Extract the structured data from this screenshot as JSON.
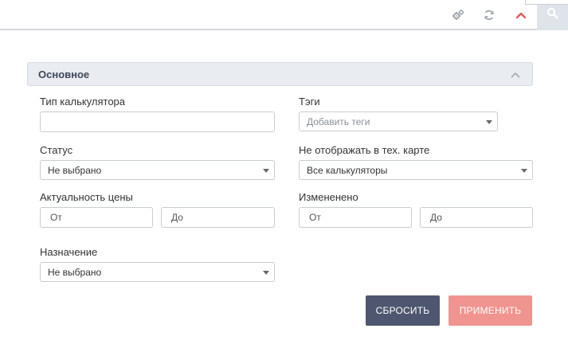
{
  "toolbar": {
    "icons": [
      "settings-gears-icon",
      "refresh-icon",
      "collapse-chevron-up-icon",
      "search-icon"
    ],
    "accent_color": "#e05a5a"
  },
  "section": {
    "title": "Основное"
  },
  "fields": {
    "calculator_type": {
      "label": "Тип калькулятора",
      "value": ""
    },
    "tags": {
      "label": "Тэги",
      "placeholder": "Добавить теги"
    },
    "status": {
      "label": "Статус",
      "value": "Не выбрано"
    },
    "hide_in_tech_card": {
      "label": "Не отображать в тех. карте",
      "value": "Все калькуляторы"
    },
    "price_relevance": {
      "label": "Актуальность цены",
      "from_placeholder": "От",
      "to_placeholder": "До"
    },
    "changed": {
      "label": "Измененено",
      "from_placeholder": "От",
      "to_placeholder": "До"
    },
    "purpose": {
      "label": "Назначение",
      "value": "Не выбрано"
    }
  },
  "buttons": {
    "reset": {
      "label": "СБРОСИТЬ",
      "color": "#4f5670"
    },
    "apply": {
      "label": "ПРИМЕНИТЬ",
      "color": "#f0948f"
    }
  }
}
